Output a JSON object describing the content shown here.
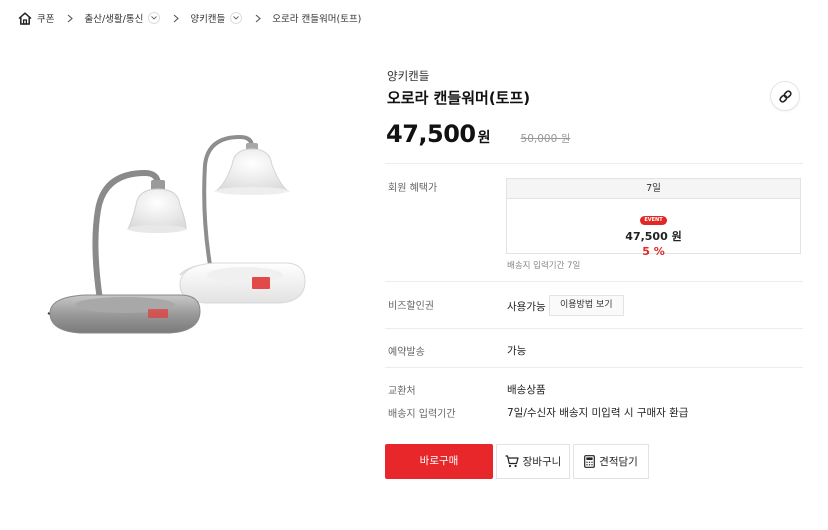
{
  "breadcrumb": {
    "home_label": "쿠폰",
    "items": [
      {
        "label": "출산/생활/통신",
        "has_dropdown": true
      },
      {
        "label": "양키캔들",
        "has_dropdown": true
      },
      {
        "label": "오로라 캔들워머(토프)",
        "has_dropdown": false
      }
    ]
  },
  "product": {
    "brand": "양키캔들",
    "name": "오로라 캔들워머(토프)",
    "price": "47,500",
    "price_unit": "원",
    "original_price": "50,000 원"
  },
  "benefit": {
    "label": "회원 혜택가",
    "period": "7일",
    "badge": "EVENT",
    "price": "47,500 원",
    "discount": "5 %",
    "note": "배송지 입력기간 7일"
  },
  "biz_coupon": {
    "label": "비즈할인권",
    "value": "사용가능",
    "button": "이용방법 보기"
  },
  "preorder": {
    "label": "예약발송",
    "value": "가능"
  },
  "exchange": {
    "label": "교환처",
    "value": "배송상품"
  },
  "address_period": {
    "label": "배송지 입력기간",
    "value": "7일/수신자 배송지 미입력 시 구매자 환급"
  },
  "actions": {
    "buy": "바로구매",
    "cart": "장바구니",
    "quote": "견적담기"
  },
  "colors": {
    "accent": "#e8272a",
    "text": "#222222",
    "muted": "#888888"
  }
}
